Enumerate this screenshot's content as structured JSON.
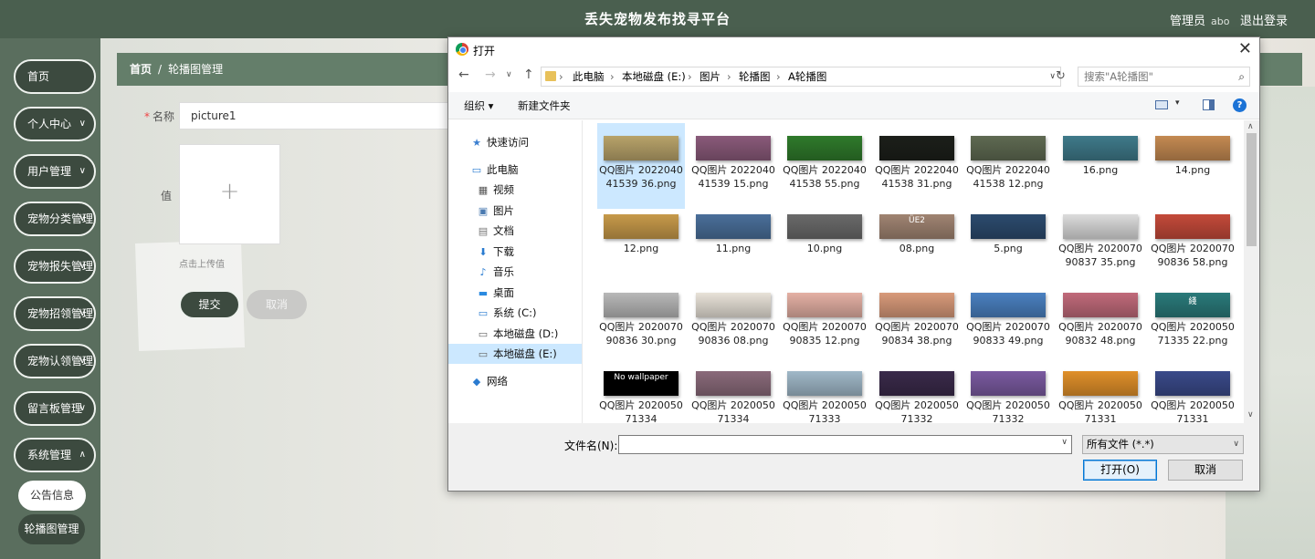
{
  "header": {
    "title": "丢失宠物发布找寻平台",
    "admin_label": "管理员",
    "admin_name": "abo",
    "logout_label": "退出登录"
  },
  "sidebar": {
    "items": [
      {
        "label": "首页"
      },
      {
        "label": "个人中心"
      },
      {
        "label": "用户管理"
      },
      {
        "label": "宠物分类管理"
      },
      {
        "label": "宠物报失管理"
      },
      {
        "label": "宠物招领管理"
      },
      {
        "label": "宠物认领管理"
      },
      {
        "label": "留言板管理"
      },
      {
        "label": "系统管理"
      }
    ],
    "subitems": [
      {
        "label": "公告信息"
      },
      {
        "label": "轮播图管理"
      }
    ]
  },
  "breadcrumb": {
    "home": "首页",
    "separator": "/",
    "current": "轮播图管理"
  },
  "form": {
    "name_label": "名称",
    "name_value": "picture1",
    "value_label": "值",
    "upload_tip": "点击上传值",
    "submit_label": "提交",
    "cancel_label": "取消"
  },
  "dialog": {
    "title": "打开",
    "address": {
      "segments": [
        "此电脑",
        "本地磁盘 (E:)",
        "图片",
        "轮播图",
        "A轮播图"
      ],
      "separator": "›"
    },
    "search_placeholder": "搜索\"A轮播图\"",
    "toolbar": {
      "organize": "组织 ▾",
      "new_folder": "新建文件夹",
      "help": "?"
    },
    "tree": [
      {
        "label": "快速访问",
        "icon": "star-icon"
      },
      {
        "label": "此电脑",
        "icon": "computer-icon"
      },
      {
        "label": "视频",
        "icon": "video-icon"
      },
      {
        "label": "图片",
        "icon": "pictures-icon"
      },
      {
        "label": "文档",
        "icon": "documents-icon"
      },
      {
        "label": "下载",
        "icon": "download-icon"
      },
      {
        "label": "音乐",
        "icon": "music-icon"
      },
      {
        "label": "桌面",
        "icon": "desktop-icon"
      },
      {
        "label": "系统 (C:)",
        "icon": "drive-icon"
      },
      {
        "label": "本地磁盘 (D:)",
        "icon": "drive-icon"
      },
      {
        "label": "本地磁盘 (E:)",
        "icon": "drive-icon"
      },
      {
        "label": "网络",
        "icon": "network-icon"
      }
    ],
    "files": [
      {
        "name": "QQ图片 202204041539 36.png",
        "color": "#b8a36a"
      },
      {
        "name": "QQ图片 202204041539 15.png",
        "color": "#8a5a7a"
      },
      {
        "name": "QQ图片 202204041538 55.png",
        "color": "#2f7a2b"
      },
      {
        "name": "QQ图片 202204041538 31.png",
        "color": "#1c1f1a"
      },
      {
        "name": "QQ图片 202204041538 12.png",
        "color": "#5f6a52"
      },
      {
        "name": "16.png",
        "color": "#3f7a8a"
      },
      {
        "name": "14.png",
        "color": "#c48a52"
      },
      {
        "name": "12.png",
        "color": "#c79a4a"
      },
      {
        "name": "11.png",
        "color": "#4a6f9a"
      },
      {
        "name": "10.png",
        "color": "#6a6a6a"
      },
      {
        "name": "08.png",
        "color": "#a08472"
      },
      {
        "name": "5.png",
        "color": "#2c4b6e"
      },
      {
        "name": "QQ图片 202007090837 35.png",
        "color": "#dcdcdc"
      },
      {
        "name": "QQ图片 202007090836 58.png",
        "color": "#c44a3a"
      },
      {
        "name": "QQ图片 202007090836 30.png",
        "color": "#b8b8b8"
      },
      {
        "name": "QQ图片 202007090836 08.png",
        "color": "#e8e2d8"
      },
      {
        "name": "QQ图片 202007090835 12.png",
        "color": "#e4b0a4"
      },
      {
        "name": "QQ图片 202007090834 38.png",
        "color": "#d89a7a"
      },
      {
        "name": "QQ图片 202007090833 49.png",
        "color": "#4a80c0"
      },
      {
        "name": "QQ图片 202007090832 48.png",
        "color": "#c06a7a"
      },
      {
        "name": "QQ图片 202005071335 22.png",
        "color": "#2a7a7a"
      },
      {
        "name": "QQ图片 202005071334",
        "color": "#000000"
      },
      {
        "name": "QQ图片 202005071334",
        "color": "#8a6a7a"
      },
      {
        "name": "QQ图片 202005071333",
        "color": "#a0b8c8"
      },
      {
        "name": "QQ图片 202005071332",
        "color": "#3a2a4a"
      },
      {
        "name": "QQ图片 202005071332",
        "color": "#7a5aa0"
      },
      {
        "name": "QQ图片 202005071331",
        "color": "#e0902a"
      },
      {
        "name": "QQ图片 202005071331",
        "color": "#3a4a8a"
      }
    ],
    "thumb_labels": {
      "thumb_10": "ÜE2",
      "thumb_20": "綫",
      "thumb_21": "No wallpaper"
    },
    "filename_label": "文件名(N):",
    "filename_value": "",
    "filetype_value": "所有文件 (*.*)",
    "open_label": "打开(O)",
    "cancel_label": "取消"
  }
}
